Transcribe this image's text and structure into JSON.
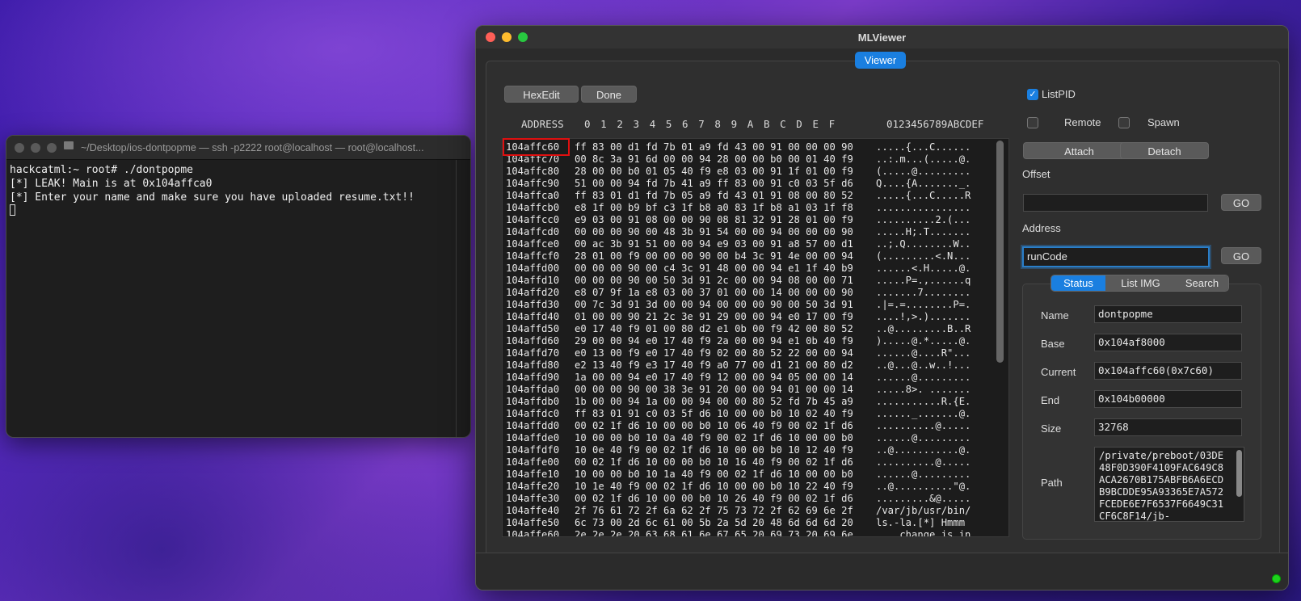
{
  "terminal": {
    "title": "~/Desktop/ios-dontpopme — ssh -p2222 root@localhost — root@localhost...",
    "lines": [
      "hackcatml:~ root# ./dontpopme",
      "[*] LEAK! Main is at 0x104affca0",
      "[*] Enter your name and make sure you have uploaded resume.txt!!"
    ]
  },
  "viewer": {
    "title": "MLViewer",
    "tab_label": "Viewer",
    "hexedit_label": "HexEdit",
    "done_label": "Done",
    "address_col": "ADDRESS",
    "byte_cols": "0  1  2  3  4  5  6  7  8  9  A  B  C  D  E  F",
    "ascii_col": "0123456789ABCDEF",
    "rows": [
      {
        "addr": "104affc60",
        "bytes": "ff 83 00 d1 fd 7b 01 a9 fd 43 00 91 00 00 00 90",
        "ascii": ".....{...C......"
      },
      {
        "addr": "104affc70",
        "bytes": "00 8c 3a 91 6d 00 00 94 28 00 00 b0 00 01 40 f9",
        "ascii": "..:.m...(.....@."
      },
      {
        "addr": "104affc80",
        "bytes": "28 00 00 b0 01 05 40 f9 e8 03 00 91 1f 01 00 f9",
        "ascii": "(.....@........."
      },
      {
        "addr": "104affc90",
        "bytes": "51 00 00 94 fd 7b 41 a9 ff 83 00 91 c0 03 5f d6",
        "ascii": "Q....{A......._."
      },
      {
        "addr": "104affca0",
        "bytes": "ff 83 01 d1 fd 7b 05 a9 fd 43 01 91 08 00 80 52",
        "ascii": ".....{...C.....R"
      },
      {
        "addr": "104affcb0",
        "bytes": "e8 1f 00 b9 bf c3 1f b8 a0 83 1f b8 a1 03 1f f8",
        "ascii": "................"
      },
      {
        "addr": "104affcc0",
        "bytes": "e9 03 00 91 08 00 00 90 08 81 32 91 28 01 00 f9",
        "ascii": "..........2.(..."
      },
      {
        "addr": "104affcd0",
        "bytes": "00 00 00 90 00 48 3b 91 54 00 00 94 00 00 00 90",
        "ascii": ".....H;.T......."
      },
      {
        "addr": "104affce0",
        "bytes": "00 ac 3b 91 51 00 00 94 e9 03 00 91 a8 57 00 d1",
        "ascii": "..;.Q........W.."
      },
      {
        "addr": "104affcf0",
        "bytes": "28 01 00 f9 00 00 00 90 00 b4 3c 91 4e 00 00 94",
        "ascii": "(.........<.N..."
      },
      {
        "addr": "104affd00",
        "bytes": "00 00 00 90 00 c4 3c 91 48 00 00 94 e1 1f 40 b9",
        "ascii": "......<.H.....@."
      },
      {
        "addr": "104affd10",
        "bytes": "00 00 00 90 00 50 3d 91 2c 00 00 94 08 00 00 71",
        "ascii": ".....P=.,......q"
      },
      {
        "addr": "104affd20",
        "bytes": "e8 07 9f 1a e8 03 00 37 01 00 00 14 00 00 00 90",
        "ascii": ".......7........"
      },
      {
        "addr": "104affd30",
        "bytes": "00 7c 3d 91 3d 00 00 94 00 00 00 90 00 50 3d 91",
        "ascii": ".|=.=........P=."
      },
      {
        "addr": "104affd40",
        "bytes": "01 00 00 90 21 2c 3e 91 29 00 00 94 e0 17 00 f9",
        "ascii": "....!,>.)......."
      },
      {
        "addr": "104affd50",
        "bytes": "e0 17 40 f9 01 00 80 d2 e1 0b 00 f9 42 00 80 52",
        "ascii": "..@.........B..R"
      },
      {
        "addr": "104affd60",
        "bytes": "29 00 00 94 e0 17 40 f9 2a 00 00 94 e1 0b 40 f9",
        "ascii": ").....@.*.....@."
      },
      {
        "addr": "104affd70",
        "bytes": "e0 13 00 f9 e0 17 40 f9 02 00 80 52 22 00 00 94",
        "ascii": "......@....R\"..."
      },
      {
        "addr": "104affd80",
        "bytes": "e2 13 40 f9 e3 17 40 f9 a0 77 00 d1 21 00 80 d2",
        "ascii": "..@...@..w..!..."
      },
      {
        "addr": "104affd90",
        "bytes": "1a 00 00 94 e0 17 40 f9 12 00 00 94 05 00 00 14",
        "ascii": "......@........."
      },
      {
        "addr": "104affda0",
        "bytes": "00 00 00 90 00 38 3e 91 20 00 00 94 01 00 00 14",
        "ascii": ".....8>. ......."
      },
      {
        "addr": "104affdb0",
        "bytes": "1b 00 00 94 1a 00 00 94 00 00 80 52 fd 7b 45 a9",
        "ascii": "...........R.{E."
      },
      {
        "addr": "104affdc0",
        "bytes": "ff 83 01 91 c0 03 5f d6 10 00 00 b0 10 02 40 f9",
        "ascii": "......_.......@."
      },
      {
        "addr": "104affdd0",
        "bytes": "00 02 1f d6 10 00 00 b0 10 06 40 f9 00 02 1f d6",
        "ascii": "..........@....."
      },
      {
        "addr": "104affde0",
        "bytes": "10 00 00 b0 10 0a 40 f9 00 02 1f d6 10 00 00 b0",
        "ascii": "......@........."
      },
      {
        "addr": "104affdf0",
        "bytes": "10 0e 40 f9 00 02 1f d6 10 00 00 b0 10 12 40 f9",
        "ascii": "..@...........@."
      },
      {
        "addr": "104affe00",
        "bytes": "00 02 1f d6 10 00 00 b0 10 16 40 f9 00 02 1f d6",
        "ascii": "..........@....."
      },
      {
        "addr": "104affe10",
        "bytes": "10 00 00 b0 10 1a 40 f9 00 02 1f d6 10 00 00 b0",
        "ascii": "......@........."
      },
      {
        "addr": "104affe20",
        "bytes": "10 1e 40 f9 00 02 1f d6 10 00 00 b0 10 22 40 f9",
        "ascii": "..@..........\"@."
      },
      {
        "addr": "104affe30",
        "bytes": "00 02 1f d6 10 00 00 b0 10 26 40 f9 00 02 1f d6",
        "ascii": ".........&@....."
      },
      {
        "addr": "104affe40",
        "bytes": "2f 76 61 72 2f 6a 62 2f 75 73 72 2f 62 69 6e 2f",
        "ascii": "/var/jb/usr/bin/"
      },
      {
        "addr": "104affe50",
        "bytes": "6c 73 00 2d 6c 61 00 5b 2a 5d 20 48 6d 6d 6d 20",
        "ascii": "ls.-la.[*] Hmmm "
      },
      {
        "addr": "104affe60",
        "bytes": "2e 2e 2e 20 63 68 61 6e 67 65 20 69 73 20 69 6e",
        "ascii": "... change is in"
      }
    ],
    "listpid_label": "ListPID",
    "remote_label": "Remote",
    "spawn_label": "Spawn",
    "attach_label": "Attach",
    "detach_label": "Detach",
    "offset_label": "Offset",
    "offset_value": "",
    "go_label": "GO",
    "address_label": "Address",
    "address_value": "runCode",
    "subtabs": [
      "Status",
      "List IMG",
      "Search"
    ],
    "status": {
      "name_label": "Name",
      "name_value": "dontpopme",
      "base_label": "Base",
      "base_value": "0x104af8000",
      "current_label": "Current",
      "current_value": "0x104affc60(0x7c60)",
      "end_label": "End",
      "end_value": "0x104b00000",
      "size_label": "Size",
      "size_value": "32768",
      "path_label": "Path",
      "path_value": "/private/preboot/03DE48F0D390F4109FAC649C8ACA2670B175ABFB6A6ECDB9BCDDE95A93365E7A572FCEDE6E7F6537F6649C31CF6C8F14/jb-"
    }
  }
}
